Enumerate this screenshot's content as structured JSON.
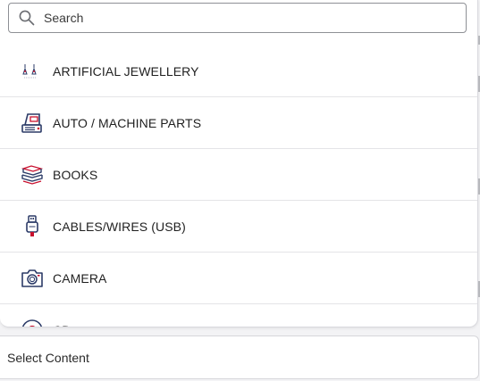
{
  "search": {
    "placeholder": "Search",
    "value": ""
  },
  "categories": [
    {
      "label": "ARTIFICIAL JEWELLERY",
      "icon": "jewellery-icon"
    },
    {
      "label": "AUTO / MACHINE PARTS",
      "icon": "machine-parts-icon"
    },
    {
      "label": "BOOKS",
      "icon": "books-icon"
    },
    {
      "label": "CABLES/WIRES (USB)",
      "icon": "usb-cable-icon"
    },
    {
      "label": "CAMERA",
      "icon": "camera-icon"
    },
    {
      "label": "CD",
      "icon": "cd-icon"
    }
  ],
  "select_content": {
    "label": "Select Content"
  },
  "colors": {
    "icon_navy": "#2b3a67",
    "icon_red": "#c8102e",
    "divider": "#e4e4e7",
    "background": "#f3f3f5"
  }
}
